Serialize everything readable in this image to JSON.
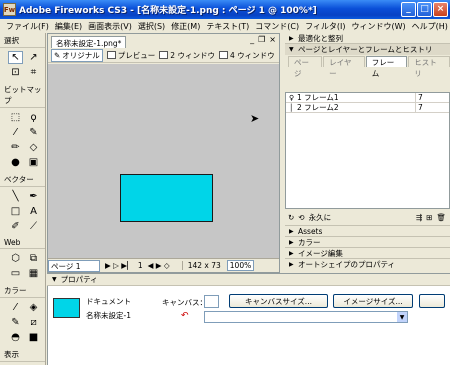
{
  "window": {
    "title": "Adobe Fireworks CS3 - [名称未設定-1.png : ページ 1 @ 100%*]",
    "app_icon": "Fw"
  },
  "menu": [
    "ファイル(F)",
    "編集(E)",
    "画面表示(V)",
    "選択(S)",
    "修正(M)",
    "テキスト(T)",
    "コマンド(C)",
    "フィルタ(I)",
    "ウィンドウ(W)",
    "ヘルプ(H)"
  ],
  "tools": {
    "sections": [
      "選択",
      "ビットマップ",
      "ベクター",
      "Web",
      "カラー",
      "表示"
    ]
  },
  "document": {
    "tab": "名称未設定-1.png*",
    "views": [
      "オリジナル",
      "プレビュー",
      "2 ウィンドウ",
      "4 ウィンドウ"
    ],
    "status": {
      "page": "ページ 1",
      "frame": "1",
      "size": "142 x 73",
      "zoom": "100%"
    },
    "shape_color": "#00d5e8"
  },
  "panels": {
    "optimize": "最適化と整列",
    "pages_group": "ページとレイヤーとフレームとヒストリ",
    "tabs": [
      "ページ",
      "レイヤー",
      "フレーム",
      "ヒストリ"
    ],
    "frames": [
      {
        "name": "1  フレーム1",
        "delay": "7"
      },
      {
        "name": "2  フレーム2",
        "delay": "7"
      }
    ],
    "loop": "永久に",
    "collapsed": [
      "Assets",
      "カラー",
      "イメージ編集",
      "オートシェイプのプロパティ"
    ]
  },
  "properties": {
    "title": "プロパティ",
    "doc_label": "ドキュメント",
    "doc_name": "名称未設定-1",
    "canvas_label": "キャンバス：",
    "canvas_size_button": "キャンバスサイズ...",
    "image_size_button": "イメージサイズ..."
  }
}
